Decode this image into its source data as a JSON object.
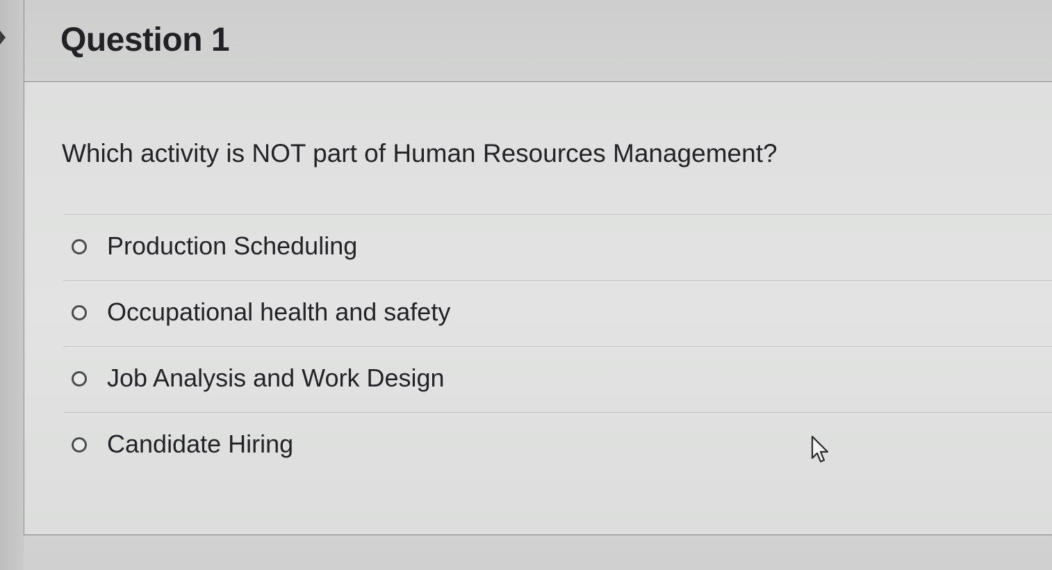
{
  "question": {
    "title": "Question 1",
    "prompt": "Which activity is NOT part of Human Resources Management?",
    "options": [
      {
        "label": "Production Scheduling",
        "selected": false
      },
      {
        "label": "Occupational health and safety",
        "selected": false
      },
      {
        "label": "Job Analysis and Work Design",
        "selected": false
      },
      {
        "label": "Candidate Hiring",
        "selected": false
      }
    ]
  },
  "icons": {
    "radio": "radio-unchecked-icon",
    "cursor": "mouse-pointer-icon",
    "collapse": "chevron-right-icon"
  },
  "colors": {
    "text": "#232327",
    "header_bg": "#d0d1d0",
    "body_bg": "#e0e1e0",
    "radio_border": "#4a4b4e"
  }
}
